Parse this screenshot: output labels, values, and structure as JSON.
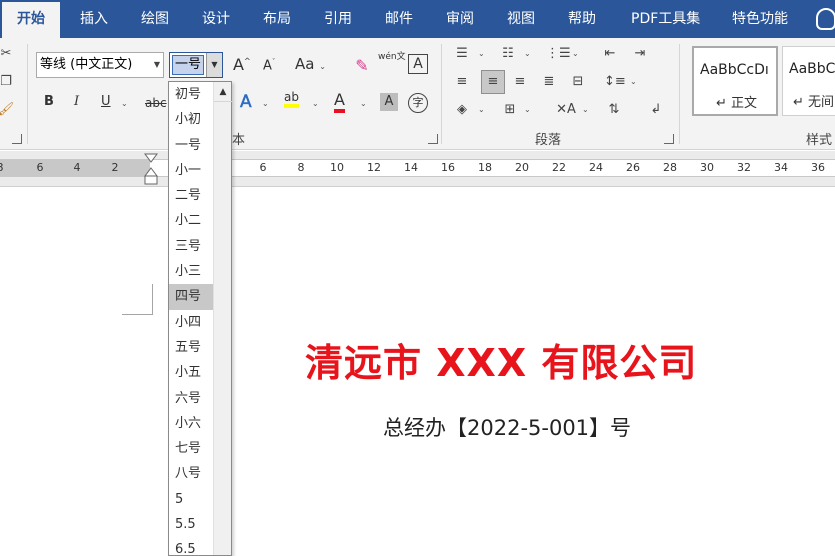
{
  "tabs": [
    {
      "label": "开始",
      "active": true
    },
    {
      "label": "插入"
    },
    {
      "label": "绘图"
    },
    {
      "label": "设计"
    },
    {
      "label": "布局"
    },
    {
      "label": "引用"
    },
    {
      "label": "邮件"
    },
    {
      "label": "审阅"
    },
    {
      "label": "视图"
    },
    {
      "label": "帮助"
    },
    {
      "label": "PDF工具集"
    },
    {
      "label": "特色功能"
    }
  ],
  "font": {
    "name": "等线 (中文正文)",
    "size": "一号",
    "group_label": "本",
    "buttons": {
      "bold": "B",
      "italic": "I",
      "underline": "U",
      "strike": "abc",
      "grow": "A",
      "shrink": "A",
      "case": "Aa",
      "phonetic": "wén文",
      "border": "A",
      "text_effect": "A",
      "highlight": "ab",
      "font_color": "A",
      "shading": "A",
      "enclose": "字"
    }
  },
  "font_size_options": [
    "初号",
    "小初",
    "一号",
    "小一",
    "二号",
    "小二",
    "三号",
    "小三",
    "四号",
    "小四",
    "五号",
    "小五",
    "六号",
    "小六",
    "七号",
    "八号",
    "5",
    "5.5",
    "6.5"
  ],
  "highlighted_option": "四号",
  "paragraph": {
    "group_label": "段落"
  },
  "styles": {
    "group_label": "样式",
    "items": [
      {
        "sample": "AaBbCcDı",
        "name": "正文",
        "selected": true
      },
      {
        "sample": "AaBbCcDı",
        "name": "无间"
      }
    ]
  },
  "ruler": {
    "ticks": [
      "8",
      "6",
      "4",
      "2",
      "6",
      "8",
      "10",
      "12",
      "14",
      "16",
      "18",
      "20",
      "22",
      "24",
      "26",
      "28",
      "30",
      "32",
      "34",
      "36"
    ]
  },
  "document": {
    "title": "清远市 XXX 有限公司",
    "subtitle": "总经办【2022-5-001】号"
  },
  "colors": {
    "accent": "#2b579a",
    "title_red": "#e8141b",
    "highlight_yellow": "#ffff00",
    "font_color_red": "#e81123"
  },
  "icons": [
    "cut-icon",
    "copy-icon",
    "format-painter-icon",
    "eraser-icon",
    "bullets-icon",
    "numbering-icon",
    "multilevel-icon",
    "decrease-indent-icon",
    "increase-indent-icon",
    "align-left-icon",
    "align-center-icon",
    "align-right-icon",
    "justify-icon",
    "distributed-icon",
    "line-spacing-icon",
    "shading-icon",
    "borders-icon",
    "chinese-layout-icon",
    "sort-icon",
    "show-marks-icon"
  ]
}
